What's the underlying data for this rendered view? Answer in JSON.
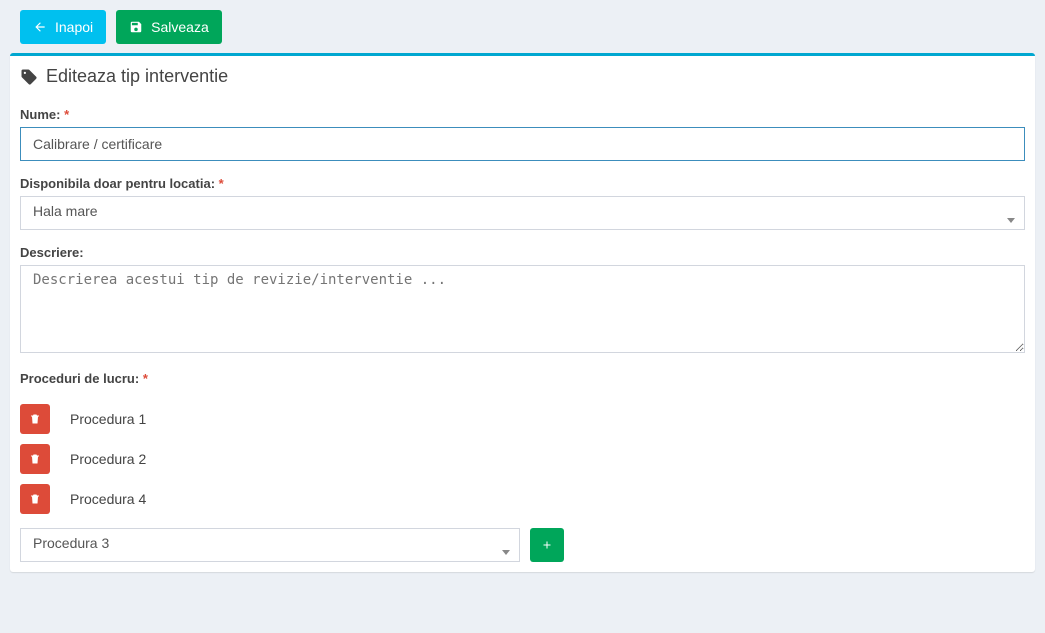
{
  "toolbar": {
    "back_label": "Inapoi",
    "save_label": "Salveaza"
  },
  "header": {
    "title": "Editeaza tip interventie"
  },
  "form": {
    "name": {
      "label": "Nume:",
      "value": "Calibrare / certificare"
    },
    "location": {
      "label": "Disponibila doar pentru locatia:",
      "selected": "Hala mare"
    },
    "description": {
      "label": "Descriere:",
      "placeholder": "Descrierea acestui tip de revizie/interventie ..."
    },
    "procedures": {
      "label": "Proceduri de lucru:",
      "items": [
        {
          "label": "Procedura 1"
        },
        {
          "label": "Procedura 2"
        },
        {
          "label": "Procedura 4"
        }
      ],
      "select_value": "Procedura 3"
    }
  }
}
